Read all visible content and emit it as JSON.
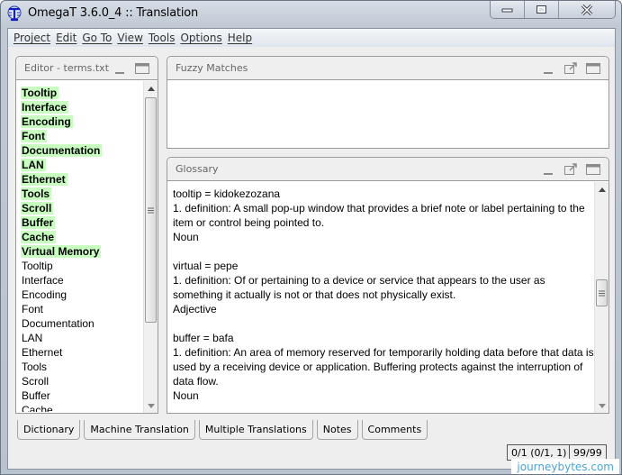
{
  "window": {
    "title": "OmegaT 3.6.0_4 :: Translation",
    "icon": "omegat-logo-icon",
    "controls": [
      "minimize",
      "maximize",
      "close"
    ]
  },
  "menu": [
    {
      "label": "Project"
    },
    {
      "label": "Edit"
    },
    {
      "label": "Go To"
    },
    {
      "label": "View"
    },
    {
      "label": "Tools"
    },
    {
      "label": "Options"
    },
    {
      "label": "Help"
    }
  ],
  "editor": {
    "title": "Editor - terms.txt",
    "highlighted_terms": [
      "Tooltip",
      "Interface",
      "Encoding",
      "Font",
      "Documentation",
      "LAN",
      "Ethernet",
      "Tools",
      "Scroll",
      "Buffer",
      "Cache",
      "Virtual Memory"
    ],
    "plain_terms": [
      "Tooltip",
      "Interface",
      "Encoding",
      "Font",
      "Documentation",
      "LAN",
      "Ethernet",
      "Tools",
      "Scroll",
      "Buffer",
      "Cache"
    ],
    "highlight_color": "#c8ffc0"
  },
  "fuzzy": {
    "title": "Fuzzy Matches"
  },
  "glossary": {
    "title": "Glossary",
    "entries": [
      {
        "term": "tooltip = kidokezozana",
        "definition": "1. definition: A small pop-up window that provides a brief note or label pertaining to the item or control being pointed to.",
        "pos": "Noun"
      },
      {
        "term": "virtual = pepe",
        "definition": "1. definition: Of or pertaining to a device or service that appears to the user as something it actually is not or that does not physically exist.",
        "pos": "Adjective"
      },
      {
        "term": "buffer = bafa",
        "definition": "1. definition: An area of memory reserved for temporarily holding data before that data is used by a receiving device or application. Buffering protects against the interruption of data flow.",
        "pos": "Noun"
      }
    ]
  },
  "tabs": [
    {
      "label": "Dictionary"
    },
    {
      "label": "Machine Translation"
    },
    {
      "label": "Multiple Translations"
    },
    {
      "label": "Notes"
    },
    {
      "label": "Comments"
    }
  ],
  "status": {
    "segments": "0/1 (0/1, 1)",
    "progress": "99/99"
  },
  "watermark": "journeybytes.com"
}
